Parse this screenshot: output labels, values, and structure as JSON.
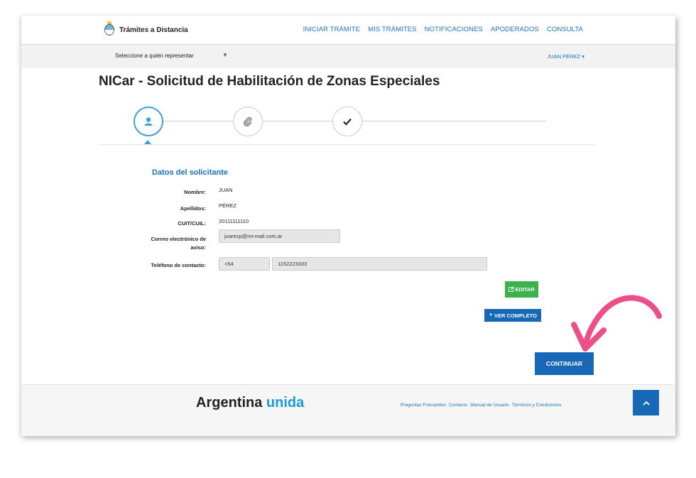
{
  "header": {
    "logo_text": "Trámites a Distancia",
    "nav": [
      "INICIAR TRÁMITE",
      "MIS TRÁMITES",
      "NOTIFICACIONES",
      "APODERADOS",
      "CONSULTA"
    ]
  },
  "repbar": {
    "label": "Seleccione a quién representar",
    "user": "JUAN PÉREZ"
  },
  "page": {
    "title": "NICar - Solicitud de Habilitación de Zonas Especiales"
  },
  "stepper": {
    "steps": [
      {
        "icon": "user-icon",
        "active": true
      },
      {
        "icon": "paperclip-icon",
        "active": false
      },
      {
        "icon": "check-icon",
        "active": false
      }
    ]
  },
  "form": {
    "section_title": "Datos del solicitante",
    "nombre_label": "Nombre:",
    "nombre_value": "JUAN",
    "apellidos_label": "Apellidos:",
    "apellidos_value": "PÉREZ",
    "cuit_label": "CUIT/CUIL:",
    "cuit_value": "20111111110",
    "correo_label": "Correo electrónico de aviso:",
    "correo_value": "juarezp@mi-mail.com.ar",
    "telefono_label": "Teléfono de contacto:",
    "telefono_prefix": "+54",
    "telefono_value": "1152223333"
  },
  "buttons": {
    "editar": "EDITAR",
    "ver_completo": "VER COMPLETO",
    "continuar": "CONTINUAR"
  },
  "footer": {
    "brand_a": "Argentina",
    "brand_b": "unida",
    "links": [
      "Preguntas Frecuentes",
      "Contacto",
      "Manual de Usuario",
      "Términos y Condiciones"
    ]
  },
  "colors": {
    "link_blue": "#1a73bd",
    "primary_blue": "#1769b8",
    "step_active": "#3aa1d3",
    "edit_green": "#3cb34a",
    "annotation_pink": "#ec4f8a"
  }
}
